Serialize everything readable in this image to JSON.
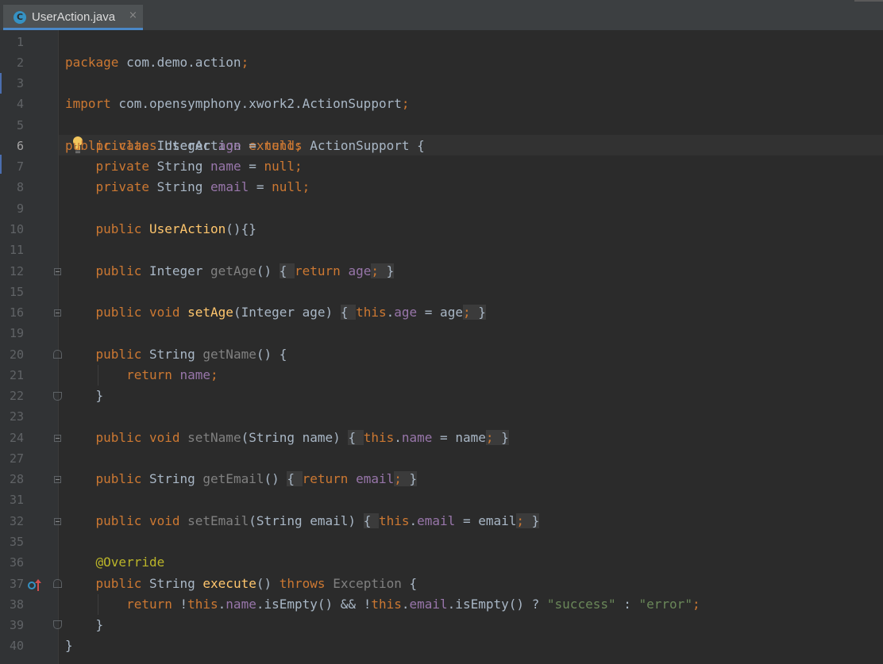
{
  "tab": {
    "icon": "class-icon",
    "icon_letter": "C",
    "title": "UserAction.java",
    "close": "×"
  },
  "line_numbers": [
    "1",
    "2",
    "3",
    "4",
    "5",
    "6",
    "7",
    "8",
    "9",
    "10",
    "11",
    "12",
    "15",
    "16",
    "19",
    "20",
    "21",
    "22",
    "23",
    "24",
    "27",
    "28",
    "31",
    "32",
    "35",
    "36",
    "37",
    "38",
    "39",
    "40"
  ],
  "colors": {
    "keyword": "#cc7832",
    "field": "#9876aa",
    "method": "#ffc66d",
    "string": "#6a8759",
    "annotation": "#bbb529",
    "text": "#a9b7c6"
  },
  "code": {
    "l1": {
      "kw": "package",
      "rest": " com.demo.action",
      "semi": ";"
    },
    "l3": {
      "kw": "import",
      "rest": " com.opensymphony.xwork2.ActionSupport",
      "semi": ";"
    },
    "l5": {
      "kw1": "public",
      "kw2": "class",
      "name": "UserAction",
      "kw3": "extends",
      "rest": "ActionSupport {"
    },
    "l6": {
      "kw": "private",
      "type": "Integer",
      "field": "age",
      "eq": " = ",
      "null": "null",
      "semi": ";"
    },
    "l7": {
      "kw": "private",
      "type": "String",
      "field": "name",
      "eq": " = ",
      "null": "null",
      "semi": ";"
    },
    "l8": {
      "kw": "private",
      "type": "String",
      "field": "email",
      "eq": " = ",
      "null": "null",
      "semi": ";"
    },
    "l10": {
      "kw": "public",
      "name": "UserAction",
      "rest": "(){}"
    },
    "l12": {
      "kw": "public",
      "type": "Integer",
      "method": "getAge",
      "paren": "()",
      "open": "{ ",
      "ret": "return",
      "field": "age",
      "semi": ";",
      "close": " }"
    },
    "l16": {
      "kw": "public",
      "kw2": "void",
      "method": "setAge",
      "params": "(Integer age)",
      "open": "{ ",
      "this": "this",
      "dot": ".",
      "field": "age",
      "assign": " = age",
      "semi": ";",
      "close": " }"
    },
    "l20": {
      "kw": "public",
      "type": "String",
      "method": "getName",
      "rest": "() {"
    },
    "l21": {
      "ret": "return",
      "field": "name",
      "semi": ";"
    },
    "l22": {
      "text": "}"
    },
    "l24": {
      "kw": "public",
      "kw2": "void",
      "method": "setName",
      "params": "(String name)",
      "open": "{ ",
      "this": "this",
      "dot": ".",
      "field": "name",
      "assign": " = name",
      "semi": ";",
      "close": " }"
    },
    "l28": {
      "kw": "public",
      "type": "String",
      "method": "getEmail",
      "paren": "()",
      "open": "{ ",
      "ret": "return",
      "field": "email",
      "semi": ";",
      "close": " }"
    },
    "l32": {
      "kw": "public",
      "kw2": "void",
      "method": "setEmail",
      "params": "(String email)",
      "open": "{ ",
      "this": "this",
      "dot": ".",
      "field": "email",
      "assign": " = email",
      "semi": ";",
      "close": " }"
    },
    "l36": {
      "ann": "@Override"
    },
    "l37": {
      "kw": "public",
      "type": "String",
      "method": "execute",
      "paren": "() ",
      "throws": "throws",
      "exc": "Exception",
      "rest": " {"
    },
    "l38": {
      "ret": "return",
      "bang1": " !",
      "this1": "this",
      "dot1": ".",
      "field1": "name",
      "call1": ".isEmpty() && !",
      "this2": "this",
      "dot2": ".",
      "field2": "email",
      "call2": ".isEmpty() ? ",
      "s1": "\"success\"",
      "colon": " : ",
      "s2": "\"error\"",
      "semi": ";"
    },
    "l39": {
      "text": "}"
    },
    "l40": {
      "text": "}"
    }
  }
}
